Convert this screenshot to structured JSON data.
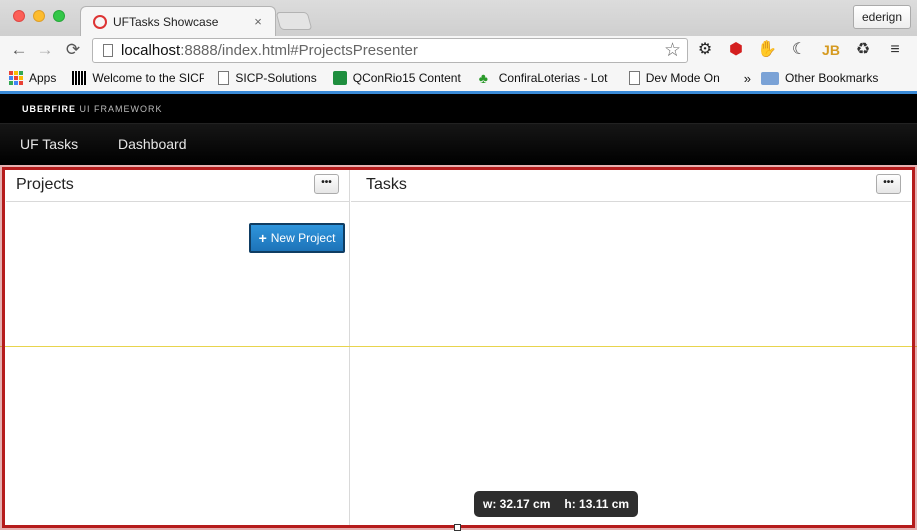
{
  "browser": {
    "tab_title": "UFTasks Showcase",
    "tab_close": "×",
    "profile": "ederign",
    "url_host": "localhost",
    "url_path": ":8888/index.html#ProjectsPresenter",
    "nav": {
      "back": "←",
      "forward": "→",
      "reload": "⟳"
    },
    "star": "☆",
    "extensions": [
      {
        "name": "settings-extension-icon",
        "glyph": "⚙",
        "color": "#222"
      },
      {
        "name": "adblock-extension-icon",
        "glyph": "⬢",
        "color": "#d41f1f"
      },
      {
        "name": "lastpass-extension-icon",
        "glyph": "✋",
        "color": "#a8712b"
      },
      {
        "name": "night-mode-extension-icon",
        "glyph": "☾",
        "color": "#333"
      },
      {
        "name": "jb-extension-icon",
        "glyph": "JB",
        "color": "#d59a20"
      },
      {
        "name": "recycle-extension-icon",
        "glyph": "♻",
        "color": "#333"
      },
      {
        "name": "menu-icon",
        "glyph": "≡",
        "color": "#333"
      }
    ],
    "bookmarks": {
      "apps": "Apps",
      "sicp": "Welcome to the SICP",
      "sicp_solutions": "SICP-Solutions",
      "qconrio": "QConRio15 Content",
      "confira": "ConfiraLoterias - Lot",
      "devmode": "Dev Mode On",
      "chevron": "»",
      "other": "Other Bookmarks"
    }
  },
  "app": {
    "brand_bold": "UBERFIRE",
    "brand_rest": " UI FRAMEWORK",
    "nav": {
      "uf_tasks": "UF Tasks",
      "dashboard": "Dashboard"
    },
    "projects": {
      "title": "Projects",
      "menu": "•••",
      "new_project": "New Project",
      "plus": "+"
    },
    "tasks": {
      "title": "Tasks",
      "menu": "•••"
    }
  },
  "measurement": {
    "width": "w: 32.17 cm",
    "height": "h: 13.11 cm"
  },
  "colors": {
    "selection": "#b51c1c",
    "accent": "#2f95dc",
    "guide": "#e8d44d"
  }
}
